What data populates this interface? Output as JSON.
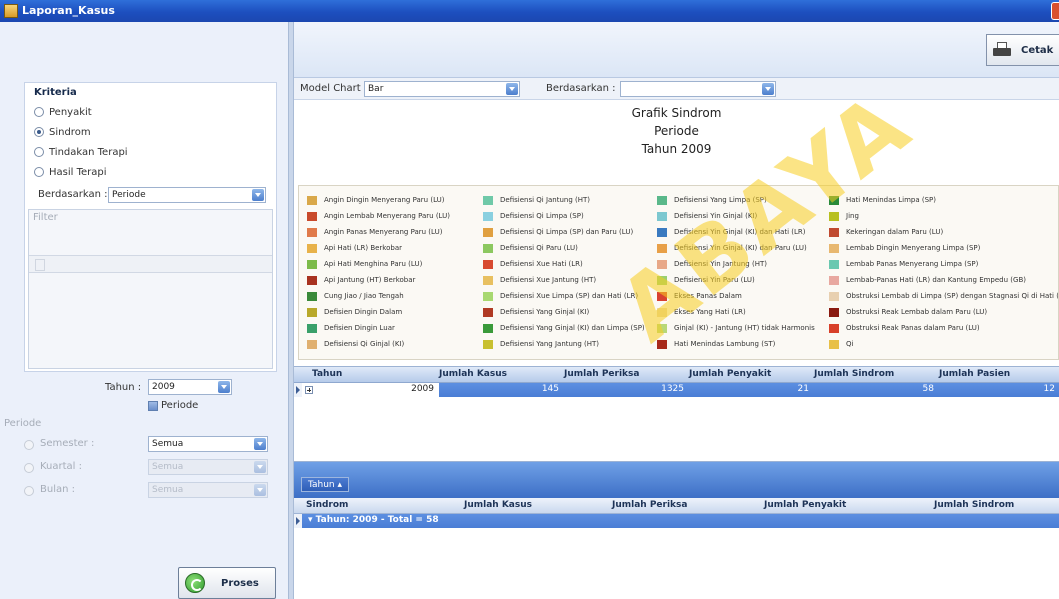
{
  "window": {
    "title": "Laporan_Kasus"
  },
  "kriteria": {
    "title": "Kriteria",
    "options": [
      {
        "label": "Penyakit",
        "checked": false
      },
      {
        "label": "Sindrom",
        "checked": true
      },
      {
        "label": "Tindakan Terapi",
        "checked": false
      },
      {
        "label": "Hasil Terapi",
        "checked": false
      }
    ],
    "berdasarkan_label": "Berdasarkan :",
    "berdasarkan_value": "Periode",
    "filter_label": "Filter"
  },
  "tahun": {
    "label": "Tahun :",
    "value": "2009"
  },
  "periode_checkbox": {
    "label": "Periode"
  },
  "periode": {
    "title": "Periode",
    "semester": {
      "label": "Semester :",
      "value": "Semua"
    },
    "kuartal": {
      "label": "Kuartal :",
      "value": "Semua"
    },
    "bulan": {
      "label": "Bulan :",
      "value": "Semua"
    }
  },
  "proses_button": {
    "label": "Proses"
  },
  "cetak_button": {
    "label": "Cetak"
  },
  "chart_options": {
    "model_label": "Model Chart :",
    "model_value": "Bar",
    "berdasarkan_label": "Berdasarkan :",
    "berdasarkan_value": ""
  },
  "chart": {
    "title_lines": [
      "Grafik Sindrom",
      "Periode",
      "Tahun 2009"
    ],
    "legend_columns": [
      [
        {
          "label": "Angin Dingin Menyerang Paru (LU)",
          "color": "#d9a84a"
        },
        {
          "label": "Angin Lembab Menyerang Paru (LU)",
          "color": "#c94a2b"
        },
        {
          "label": "Angin Panas Menyerang Paru (LU)",
          "color": "#e07a4a"
        },
        {
          "label": "Api Hati (LR) Berkobar",
          "color": "#e8b24a"
        },
        {
          "label": "Api Hati Menghina Paru (LU)",
          "color": "#7dbb4a"
        },
        {
          "label": "Api Jantung (HT) Berkobar",
          "color": "#a83220"
        },
        {
          "label": "Cung Jiao / Jiao Tengah",
          "color": "#3a8a3a"
        },
        {
          "label": "Defisien Dingin Dalam",
          "color": "#b8a82a"
        },
        {
          "label": "Defisien Dingin Luar",
          "color": "#3aa06a"
        },
        {
          "label": "Defisiensi Qi Ginjal (KI)",
          "color": "#e0b070"
        }
      ],
      [
        {
          "label": "Defisiensi Qi Jantung (HT)",
          "color": "#6fc9a8"
        },
        {
          "label": "Defisiensi Qi Limpa (SP)",
          "color": "#8ad0e0"
        },
        {
          "label": "Defisiensi Qi Limpa (SP) dan Paru (LU)",
          "color": "#e0a040"
        },
        {
          "label": "Defisiensi Qi Paru (LU)",
          "color": "#8cc860"
        },
        {
          "label": "Defisiensi Xue Hati (LR)",
          "color": "#d84a30"
        },
        {
          "label": "Defisiensi Xue Jantung (HT)",
          "color": "#e8c060"
        },
        {
          "label": "Defisiensi Xue Limpa (SP) dan Hati (LR)",
          "color": "#a8d870"
        },
        {
          "label": "Defisiensi Yang Ginjal (KI)",
          "color": "#b03a24"
        },
        {
          "label": "Defisiensi Yang Ginjal (KI) dan Limpa (SP)",
          "color": "#3a9a3a"
        },
        {
          "label": "Defisiensi Yang Jantung (HT)",
          "color": "#c8c030"
        }
      ],
      [
        {
          "label": "Defisiensi Yang Limpa (SP)",
          "color": "#5ab88a"
        },
        {
          "label": "Defisiensi Yin Ginjal (KI)",
          "color": "#7cc8d0"
        },
        {
          "label": "Defisiensi Yin Ginjal (KI) dan Hati (LR)",
          "color": "#3a7ac0"
        },
        {
          "label": "Defisiensi Yin Ginjal (KI) dan Paru (LU)",
          "color": "#e8a048"
        },
        {
          "label": "Defisiensi Yin Jantung (HT)",
          "color": "#e8a888"
        },
        {
          "label": "Defisiensi Yin Paru (LU)",
          "color": "#9ad070"
        },
        {
          "label": "Ekses Panas Dalam",
          "color": "#d84030"
        },
        {
          "label": "Ekses Yang Hati (LR)",
          "color": "#e8d8a8"
        },
        {
          "label": "Ginjal (KI) - Jantung (HT) tidak Harmonis",
          "color": "#b8d878"
        },
        {
          "label": "Hati Menindas Lambung (ST)",
          "color": "#a82a1a"
        }
      ],
      [
        {
          "label": "Hati Menindas Limpa (SP)",
          "color": "#2a8a3a"
        },
        {
          "label": "Jing",
          "color": "#b8c020"
        },
        {
          "label": "Kekeringan dalam Paru (LU)",
          "color": "#c04a30"
        },
        {
          "label": "Lembab Dingin Menyerang Limpa (SP)",
          "color": "#e8b870"
        },
        {
          "label": "Lembab Panas Menyerang Limpa (SP)",
          "color": "#6ac8b0"
        },
        {
          "label": "Lembab-Panas Hati (LR) dan Kantung Empedu (GB)",
          "color": "#e8a8a0"
        },
        {
          "label": "Obstruksi Lembab di Limpa (SP) dengan Stagnasi Qi di Hati (LR)",
          "color": "#e8d0b0"
        },
        {
          "label": "Obstruksi Reak Lembab dalam Paru (LU)",
          "color": "#8a1a10"
        },
        {
          "label": "Obstruksi Reak Panas dalam Paru (LU)",
          "color": "#d8402a"
        },
        {
          "label": "Qi",
          "color": "#e8c048"
        }
      ]
    ]
  },
  "summary_grid": {
    "headers": [
      "Tahun",
      "Jumlah Kasus",
      "Jumlah Periksa",
      "Jumlah Penyakit",
      "Jumlah Sindrom",
      "Jumlah Pasien"
    ],
    "row": [
      "2009",
      "145",
      "1325",
      "21",
      "58",
      "12"
    ]
  },
  "detail_grid": {
    "group_chip": "Tahun ▴",
    "headers": [
      "Sindrom",
      "Jumlah Kasus",
      "Jumlah Periksa",
      "Jumlah Penyakit",
      "Jumlah Sindrom"
    ],
    "group_row": "▾ Tahun: 2009    -  Total = 58"
  },
  "watermark": {
    "text": "ABAYA"
  },
  "colors": {
    "titlebar": "#1d4fbf",
    "selection": "#4a7dd5",
    "watermark": "#f8ce21"
  }
}
